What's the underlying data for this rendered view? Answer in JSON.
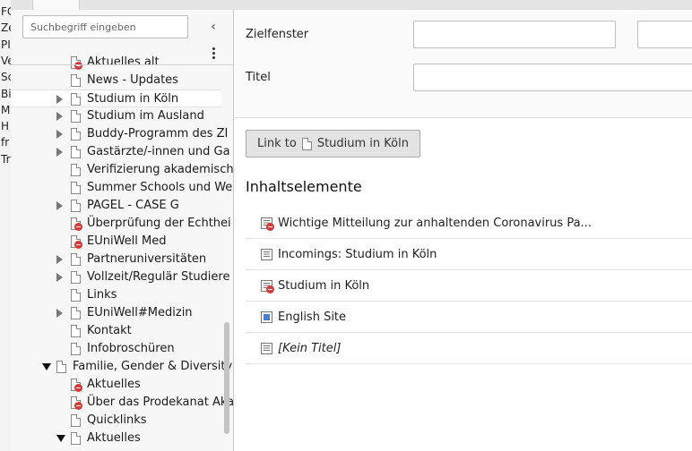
{
  "left_strip": [
    "FC",
    "Ze",
    "PI",
    "Ve",
    "Sc",
    "Bi",
    "M",
    "H",
    "fr",
    "Tr"
  ],
  "tree": {
    "search_placeholder": "Suchbegriff eingeben",
    "items": [
      {
        "label": "Aktuelles alt",
        "level": 2,
        "toggle": "none",
        "hidden": true
      },
      {
        "label": "News - Updates",
        "level": 2,
        "toggle": "none",
        "hidden": false
      },
      {
        "label": "Studium in Köln",
        "level": 2,
        "toggle": "collapsed",
        "hidden": false,
        "selected": true
      },
      {
        "label": "Studium im Ausland",
        "level": 2,
        "toggle": "collapsed",
        "hidden": false
      },
      {
        "label": "Buddy-Programm des ZI",
        "level": 2,
        "toggle": "collapsed",
        "hidden": false
      },
      {
        "label": "Gastärzte/-innen und Ga",
        "level": 2,
        "toggle": "collapsed",
        "hidden": false
      },
      {
        "label": "Verifizierung akademisch",
        "level": 2,
        "toggle": "none",
        "hidden": false
      },
      {
        "label": "Summer Schools und We",
        "level": 2,
        "toggle": "none",
        "hidden": false
      },
      {
        "label": "PAGEL - CASE G",
        "level": 2,
        "toggle": "collapsed",
        "hidden": false
      },
      {
        "label": "Überprüfung der Echthei",
        "level": 2,
        "toggle": "none",
        "hidden": true
      },
      {
        "label": "EUniWell Med",
        "level": 2,
        "toggle": "none",
        "hidden": true
      },
      {
        "label": "Partneruniversitäten",
        "level": 2,
        "toggle": "collapsed",
        "hidden": false
      },
      {
        "label": "Vollzeit/Regulär Studiere",
        "level": 2,
        "toggle": "collapsed",
        "hidden": false
      },
      {
        "label": "Links",
        "level": 2,
        "toggle": "none",
        "hidden": false
      },
      {
        "label": "EUniWell#Medizin",
        "level": 2,
        "toggle": "collapsed",
        "hidden": false
      },
      {
        "label": "Kontakt",
        "level": 2,
        "toggle": "none",
        "hidden": false
      },
      {
        "label": "Infobroschüren",
        "level": 2,
        "toggle": "none",
        "hidden": false
      },
      {
        "label": "Familie, Gender & Diversity",
        "level": 1,
        "toggle": "expanded",
        "hidden": false
      },
      {
        "label": "Aktuelles",
        "level": 2,
        "toggle": "none",
        "hidden": true
      },
      {
        "label": "Über das Prodekanat Aka",
        "level": 2,
        "toggle": "none",
        "hidden": true
      },
      {
        "label": "Quicklinks",
        "level": 2,
        "toggle": "none",
        "hidden": false
      },
      {
        "label": "Aktuelles",
        "level": 2,
        "toggle": "expanded",
        "hidden": false
      }
    ]
  },
  "form": {
    "target_label": "Zielfenster",
    "target_value": "",
    "target_value2": "",
    "title_label": "Titel",
    "title_value": ""
  },
  "link_button": {
    "prefix": "Link to",
    "page": "Studium in Köln"
  },
  "content_elements": {
    "heading": "Inhaltselemente",
    "items": [
      {
        "label": "Wichtige Mitteilung zur anhaltenden Coronavirus Pa...",
        "icon": "text-hidden-icon",
        "italic": false
      },
      {
        "label": "Incomings: Studium in Köln",
        "icon": "text-icon",
        "italic": false
      },
      {
        "label": "Studium in Köln",
        "icon": "text-hidden-icon",
        "italic": false
      },
      {
        "label": "English Site",
        "icon": "text-image-icon",
        "italic": false
      },
      {
        "label": "[Kein Titel]",
        "icon": "text-icon",
        "italic": true
      }
    ]
  }
}
